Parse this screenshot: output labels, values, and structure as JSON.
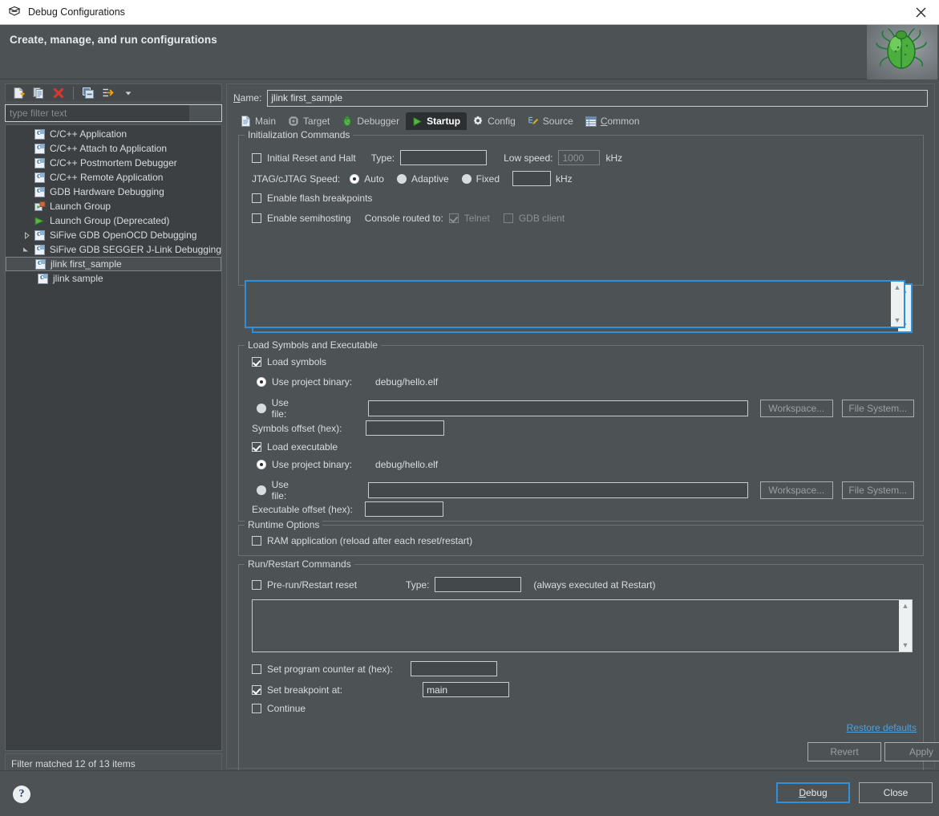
{
  "window": {
    "title": "Debug Configurations",
    "app_icon": "debug-configurations-icon",
    "close_icon": "close-icon"
  },
  "header": {
    "title": "Create, manage, and run configurations",
    "decoration_icon": "green-bug-icon"
  },
  "left_panel": {
    "toolbar": [
      {
        "name": "new-configuration-button",
        "icon": "new-document-icon",
        "tooltip": "New launch configuration"
      },
      {
        "name": "duplicate-configuration-button",
        "icon": "duplicate-icon",
        "tooltip": "Duplicate"
      },
      {
        "name": "delete-configuration-button",
        "icon": "delete-red-x-icon",
        "tooltip": "Delete"
      },
      {
        "name": "collapse-all-button",
        "icon": "collapse-all-icon",
        "tooltip": "Collapse All"
      },
      {
        "name": "filter-launch-configurations-button",
        "icon": "filter-arrow-icon",
        "tooltip": "Filter"
      },
      {
        "name": "view-menu-button",
        "icon": "chevron-down-icon",
        "tooltip": "View Menu"
      }
    ],
    "filter": {
      "value": "",
      "placeholder": "type filter text"
    },
    "tree": [
      {
        "label": "C/C++ Application",
        "icon": "c-file-icon",
        "indent": 1,
        "expander": "none",
        "selected": false
      },
      {
        "label": "C/C++ Attach to Application",
        "icon": "c-file-icon",
        "indent": 1,
        "expander": "none",
        "selected": false
      },
      {
        "label": "C/C++ Postmortem Debugger",
        "icon": "c-file-icon",
        "indent": 1,
        "expander": "none",
        "selected": false
      },
      {
        "label": "C/C++ Remote Application",
        "icon": "c-file-icon",
        "indent": 1,
        "expander": "none",
        "selected": false
      },
      {
        "label": "GDB Hardware Debugging",
        "icon": "c-file-icon",
        "indent": 1,
        "expander": "none",
        "selected": false
      },
      {
        "label": "Launch Group",
        "icon": "launch-group-icon",
        "indent": 1,
        "expander": "none",
        "selected": false
      },
      {
        "label": "Launch Group (Deprecated)",
        "icon": "launch-group-deprecated-icon",
        "indent": 1,
        "expander": "none",
        "selected": false
      },
      {
        "label": "SiFive GDB OpenOCD Debugging",
        "icon": "c-file-icon",
        "indent": 1,
        "expander": "collapsed",
        "selected": false
      },
      {
        "label": "SiFive GDB SEGGER J-Link Debugging",
        "icon": "c-file-icon",
        "indent": 1,
        "expander": "expanded",
        "selected": false
      },
      {
        "label": "jlink first_sample",
        "icon": "c-file-icon",
        "indent": 2,
        "expander": "none",
        "selected": true
      },
      {
        "label": "jlink sample",
        "icon": "c-file-icon",
        "indent": 2,
        "expander": "none",
        "selected": false
      }
    ],
    "filter_status": "Filter matched 12 of 13 items"
  },
  "right_panel": {
    "name_label": "Name:",
    "name_label_mnemonic": "N",
    "name_value": "jlink first_sample",
    "tabs": [
      {
        "label": "Main",
        "icon": "document-icon",
        "active": false
      },
      {
        "label": "Target",
        "icon": "chip-icon",
        "active": false
      },
      {
        "label": "Debugger",
        "icon": "bug-icon",
        "active": false
      },
      {
        "label": "Startup",
        "icon": "green-play-icon",
        "active": true
      },
      {
        "label": "Config",
        "icon": "gear-icon",
        "active": false
      },
      {
        "label": "Source",
        "icon": "source-pencil-icon",
        "active": false
      },
      {
        "label": "Common",
        "icon": "common-table-icon",
        "active": false
      }
    ]
  },
  "startup": {
    "init_group": {
      "legend": "Initialization Commands",
      "initial_reset_label": "Initial Reset and Halt",
      "initial_reset_checked": false,
      "type_label": "Type:",
      "type_value": "",
      "low_speed_label": "Low speed:",
      "low_speed_value": "1000",
      "low_speed_enabled": false,
      "low_speed_unit": "kHz",
      "jtag_speed_label": "JTAG/cJTAG Speed:",
      "speed_options": [
        {
          "label": "Auto",
          "selected": true
        },
        {
          "label": "Adaptive",
          "selected": false
        },
        {
          "label": "Fixed",
          "selected": false
        }
      ],
      "fixed_speed_value": "",
      "fixed_speed_unit": "kHz",
      "flash_breakpoints_label": "Enable flash breakpoints",
      "flash_breakpoints_checked": false,
      "semihosting_label": "Enable semihosting",
      "semihosting_checked": false,
      "console_routed_label": "Console routed to:",
      "console_telnet_label": "Telnet",
      "console_telnet_checked": true,
      "console_telnet_enabled": false,
      "console_gdb_label": "GDB client",
      "console_gdb_checked": false,
      "console_gdb_enabled": false,
      "commands_text": "",
      "scroll_up_icon": "chevron-up-icon",
      "scroll_down_icon": "chevron-down-icon"
    },
    "load_group": {
      "legend": "Load Symbols and Executable",
      "load_symbols_label": "Load symbols",
      "load_symbols_checked": true,
      "symbols_project_binary_label": "Use project binary:",
      "symbols_project_binary_value": "debug/hello.elf",
      "symbols_project_binary_selected": true,
      "symbols_use_file_label": "Use file:",
      "symbols_use_file_selected": false,
      "symbols_use_file_value": "",
      "symbols_workspace_button": "Workspace...",
      "symbols_filesystem_button": "File System...",
      "symbols_offset_label": "Symbols offset (hex):",
      "symbols_offset_value": "",
      "load_executable_label": "Load executable",
      "load_executable_checked": true,
      "exec_project_binary_label": "Use project binary:",
      "exec_project_binary_value": "debug/hello.elf",
      "exec_project_binary_selected": true,
      "exec_use_file_label": "Use file:",
      "exec_use_file_selected": false,
      "exec_use_file_value": "",
      "exec_workspace_button": "Workspace...",
      "exec_filesystem_button": "File System...",
      "exec_offset_label": "Executable offset (hex):",
      "exec_offset_value": ""
    },
    "runtime_group": {
      "legend": "Runtime Options",
      "ram_application_label": "RAM application (reload after each reset/restart)",
      "ram_application_checked": false
    },
    "run_group": {
      "legend": "Run/Restart Commands",
      "prerun_reset_label": "Pre-run/Restart reset",
      "prerun_reset_checked": false,
      "type_label": "Type:",
      "type_value": "",
      "always_executed_note": "(always executed at Restart)",
      "commands_text": "",
      "set_pc_label": "Set program counter at (hex):",
      "set_pc_checked": false,
      "set_pc_value": "",
      "set_breakpoint_label": "Set breakpoint at:",
      "set_breakpoint_checked": true,
      "set_breakpoint_value": "main",
      "continue_label": "Continue",
      "continue_checked": false,
      "scroll_up_icon": "chevron-up-icon",
      "scroll_down_icon": "chevron-down-icon"
    },
    "restore_defaults_link": "Restore defaults",
    "revert_button": "Revert",
    "revert_enabled": false,
    "apply_button": "Apply",
    "apply_enabled": false
  },
  "footer": {
    "help_icon": "help-question-icon",
    "debug_button": "Debug",
    "debug_mnemonic": "D",
    "close_button": "Close"
  },
  "colors": {
    "background": "#4d5254",
    "panel": "#3c4042",
    "accent_blue": "#2f8fd8",
    "link_blue": "#4aa3e0",
    "text": "#d6d9da",
    "text_disabled": "#8d9295",
    "tab_active_bg": "#2b2f31",
    "border": "#6c7174"
  }
}
